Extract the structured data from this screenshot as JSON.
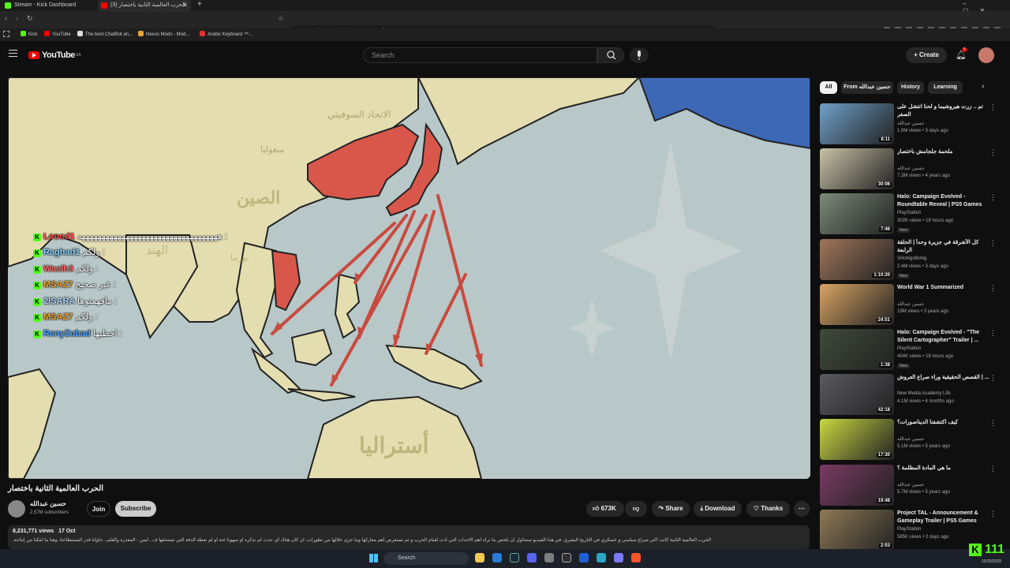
{
  "browser": {
    "tabs": [
      {
        "label": "Stream - Kick Dashboard"
      },
      {
        "label": "(3) الحرب العالمية الثانية باختصار"
      }
    ],
    "url": "youtube.com/watch?v=2CMoyNf4_1M&t=2122s",
    "bookmarks": [
      "Kick",
      "YouTube",
      "The best ChatBot an...",
      "Nexus Mods - Mod...",
      "Arabic Keyboard ™..."
    ]
  },
  "youtube": {
    "logo": "YouTube",
    "country": "SA",
    "search_placeholder": "Search",
    "create_label": "Create",
    "notif_count": "5"
  },
  "video": {
    "map_labels": {
      "ussr": "الاتحاد السوفيتي",
      "mongolia": "منغوليا",
      "china": "الصين",
      "india": "الهند",
      "burma": "بورما",
      "australia": "أستراليا"
    },
    "title": "الحرب العالمية الثانية باختصار",
    "channel": "حسين عبدالله",
    "subscribers": "2.57M subscribers",
    "join_label": "Join",
    "subscribe_label": "Subscribe",
    "likes": "673K",
    "share_label": "Share",
    "download_label": "Download",
    "thanks_label": "Thanks",
    "views": "8,231,771 views",
    "date": "17 Oct",
    "description": "الحرب العالمية الثانية كانت اكبر صراع سياسي و عسكري في التاريخ البشري. في هذا الفيديو سنحاول ان نلخص ما تراه اهم الاحداث التي ادت لقيام الحرب و ثم نستعرض أهم معاركها وما جرى خلالها من تطورات. ان كان هناك أي حدث لم نذكره او سهونا عنه او لم نعطه الدقة التي تستحقها ف.. ليس - المعذرة والفلم.. حاولنا قدر المستطاعنا، وهنا ما امكنا من إنتاجه."
  },
  "chat_overlay": [
    {
      "user": "Loood1",
      "msg": "هههههههههههههههههههههههههههههههههههه :",
      "color": "#ff4d4d"
    },
    {
      "user": "Raghad1",
      "msg": "ولكم :",
      "color": "#87cefa"
    },
    {
      "user": "Waelh3",
      "msg": "ولكم :",
      "color": "#ff6b6b"
    },
    {
      "user": "MSAZ7",
      "msg": "غير صحيح :",
      "color": "#f5a623"
    },
    {
      "user": "2ISARA",
      "msg": "مافهمتوها :",
      "color": "#b0d8ff"
    },
    {
      "user": "MSAZ7",
      "msg": "ولكم :",
      "color": "#f5a623"
    },
    {
      "user": "RenyZubad",
      "msg": "اخطيها :",
      "color": "#4aa3ff"
    }
  ],
  "chips": [
    "All",
    "From حسين عبدالله",
    "History",
    "Learning"
  ],
  "recommendations": [
    {
      "title": "تم .. زرت هيروشيما و لحنا انتشل على الصفر",
      "channel": "حسين عبدالله",
      "meta": "1.9M views • 3 days ago",
      "dur": "8:11",
      "color": "#6fa0c8",
      "new": ""
    },
    {
      "title": "ملحمة جلجامش باختصار",
      "channel": "حسين عبدالله",
      "meta": "7.3M views • 4 years ago",
      "dur": "30:06",
      "color": "#c9c2a8",
      "new": ""
    },
    {
      "title": "Halo: Campaign Evolved - Roundtable Reveal | PS5 Games",
      "channel": "PlayStation",
      "meta": "302K views • 18 hours ago",
      "dur": "7:46",
      "color": "#7b8a79",
      "new": "New"
    },
    {
      "title": "كل الأشرقة في جزيرة وحداً | الحلقة الرابعة",
      "channel": "SHoNgxBoNg",
      "meta": "2.4M views • 3 days ago",
      "dur": "1:10:20",
      "color": "#a0765a",
      "new": "New"
    },
    {
      "title": "World War 1 Summarized",
      "channel": "حسين عبدالله",
      "meta": "19M views • 3 years ago",
      "dur": "24:51",
      "color": "#d9a464",
      "new": ""
    },
    {
      "title": "Halo: Campaign Evolved - \"The Silent Cartographer\" Trailer | ...",
      "channel": "PlayStation",
      "meta": "454K views • 18 hours ago",
      "dur": "1:38",
      "color": "#3f4a3a",
      "new": "New"
    },
    {
      "title": "القصص الحقيقية وراء صراع العروش | ...",
      "channel": "New Media Academy Life",
      "meta": "4.1M views • 4 months ago",
      "dur": "42:18",
      "color": "#5a5a5f",
      "new": ""
    },
    {
      "title": "كيف اكتشفنا الديناصورات؟",
      "channel": "حسين عبدالله",
      "meta": "5.1M views • 5 years ago",
      "dur": "17:30",
      "color": "#c8d840",
      "new": ""
    },
    {
      "title": "ما هي المادة المظلمة ؟",
      "channel": "حسين عبدالله",
      "meta": "5.7M views • 5 years ago",
      "dur": "19:48",
      "color": "#7a3a63",
      "new": ""
    },
    {
      "title": "Project TAL - Announcement & Gameplay Trailer | PS5 Games",
      "channel": "PlayStation",
      "meta": "585K views • 2 days ago",
      "dur": "2:03",
      "color": "#8f7a55",
      "new": ""
    }
  ],
  "taskbar": {
    "search": "Search",
    "kick_count": "111",
    "date": "10/25/2025"
  },
  "colors": {
    "kick": "#53fc18",
    "japan_red": "#d9574a",
    "ocean": "#b8c7c7",
    "land": "#e4ddb0"
  },
  "icons": [
    "kick-icon",
    "youtube-icon",
    "search-icon",
    "mic-icon",
    "bell-icon",
    "menu-icon",
    "like-icon",
    "dislike-icon",
    "share-icon",
    "download-icon",
    "thanks-icon",
    "windows-icon"
  ]
}
